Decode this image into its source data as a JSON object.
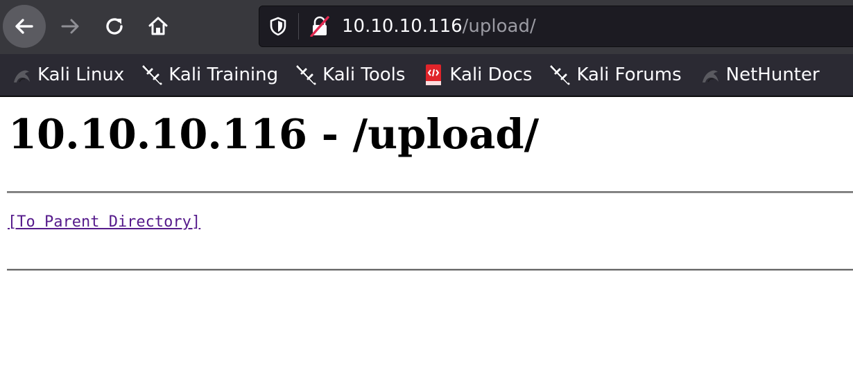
{
  "browser": {
    "url": {
      "host": "10.10.10.116",
      "path": "/upload/"
    },
    "icons": {
      "back": "arrow-left-icon",
      "forward": "arrow-right-icon",
      "reload": "reload-icon",
      "home": "home-icon",
      "tracking_protection": "shield-icon",
      "connection": "insecure-lock-icon"
    },
    "bookmarks": [
      {
        "label": "Kali Linux",
        "icon": "kali-dragon-icon"
      },
      {
        "label": "Kali Training",
        "icon": "kali-sword-icon"
      },
      {
        "label": "Kali Tools",
        "icon": "kali-sword-icon"
      },
      {
        "label": "Kali Docs",
        "icon": "kali-docs-icon"
      },
      {
        "label": "Kali Forums",
        "icon": "kali-sword-icon"
      },
      {
        "label": "NetHunter",
        "icon": "kali-dragon-icon"
      }
    ],
    "colors": {
      "toolbar": "#38383d",
      "urlbar": "#1c1b22",
      "bookmarks_bar": "#2b2a33",
      "docs_icon": "#e0242a"
    }
  },
  "page": {
    "title": "10.10.10.116 - /upload/",
    "parent_link": "[To Parent Directory]",
    "colors": {
      "link_visited": "#551a8b"
    }
  }
}
